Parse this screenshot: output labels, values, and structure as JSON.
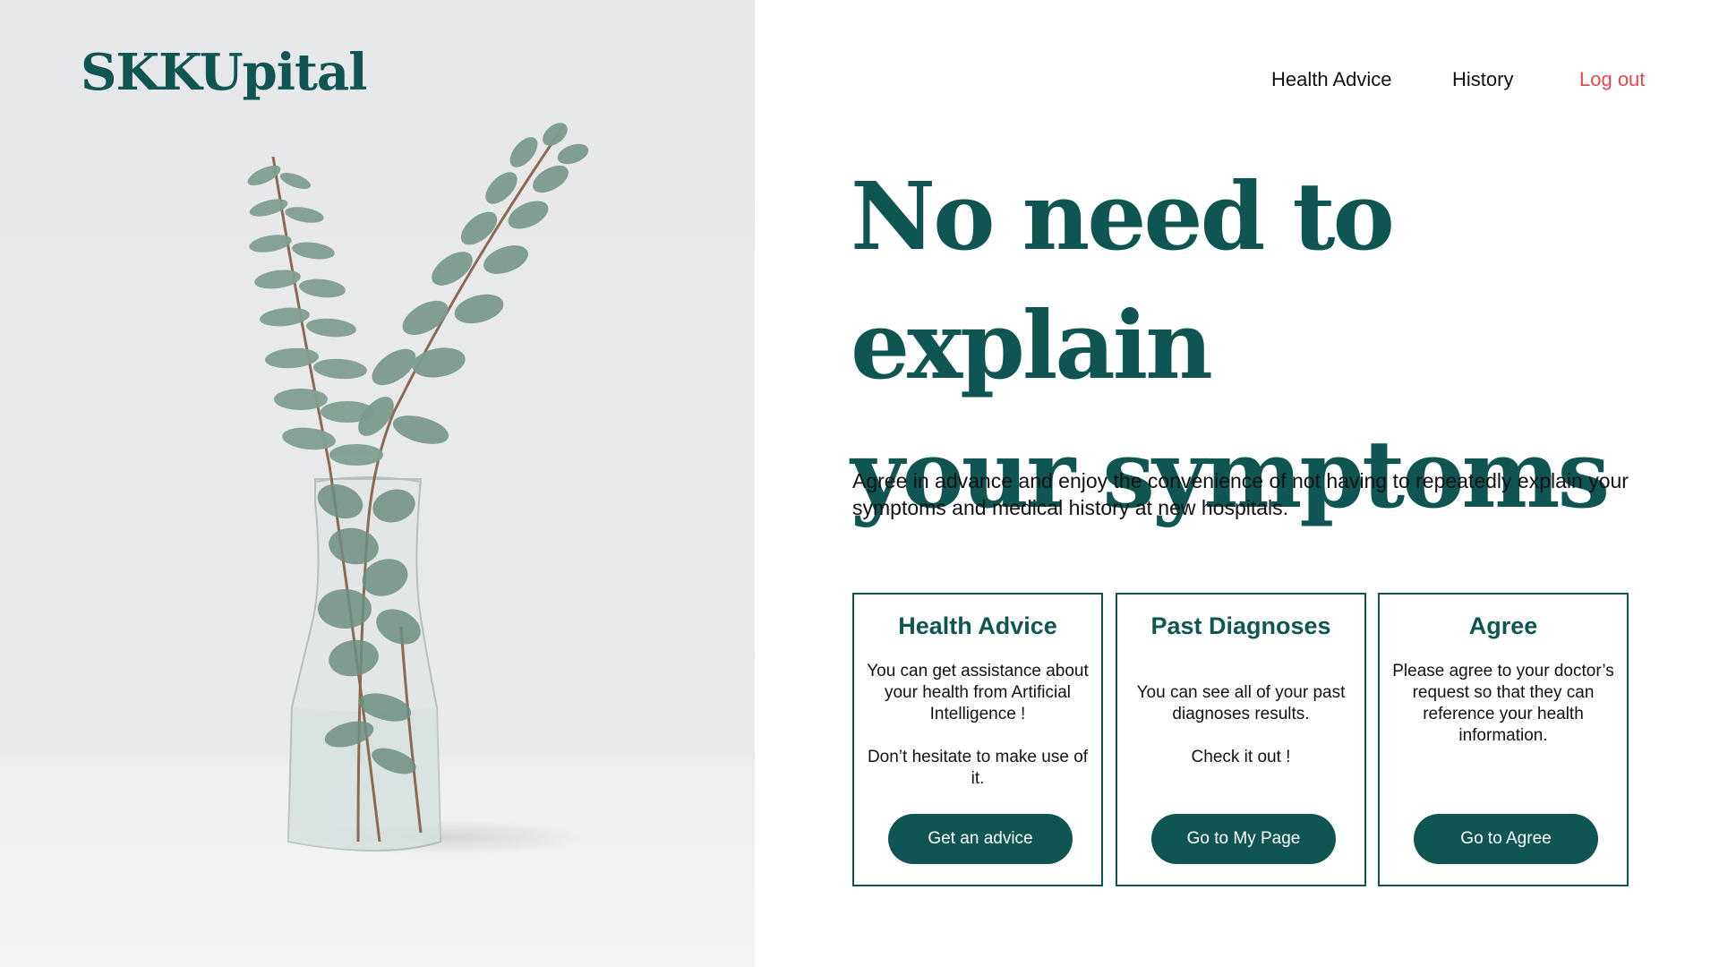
{
  "brand": {
    "logo_text": "SKKUpital",
    "primary_color": "#0f5652",
    "accent_color": "#e5484d"
  },
  "nav": {
    "items": [
      {
        "label": "Health Advice"
      },
      {
        "label": "History"
      },
      {
        "label": "Log out"
      }
    ]
  },
  "hero": {
    "title_line1": "No need to explain",
    "title_line2": "your symptoms",
    "subtitle": "Agree in advance and enjoy the convenience of not having to repeatedly explain your symptoms and medical history at new hospitals."
  },
  "cards": [
    {
      "title": "Health Advice",
      "paragraphs": [
        "You can get assistance about your health from Artificial Intelligence !",
        "Don’t hesitate to make use of it."
      ],
      "button_label": "Get an advice"
    },
    {
      "title": "Past Diagnoses",
      "paragraphs": [
        "You can see all of your past diagnoses results.",
        "Check it out !"
      ],
      "button_label": "Go to My Page"
    },
    {
      "title": "Agree",
      "paragraphs": [
        "Please agree to your doctor’s request so that they can reference your health information."
      ],
      "button_label": "Go to Agree"
    }
  ],
  "hero_image": {
    "icon": "eucalyptus-vase-photo"
  }
}
